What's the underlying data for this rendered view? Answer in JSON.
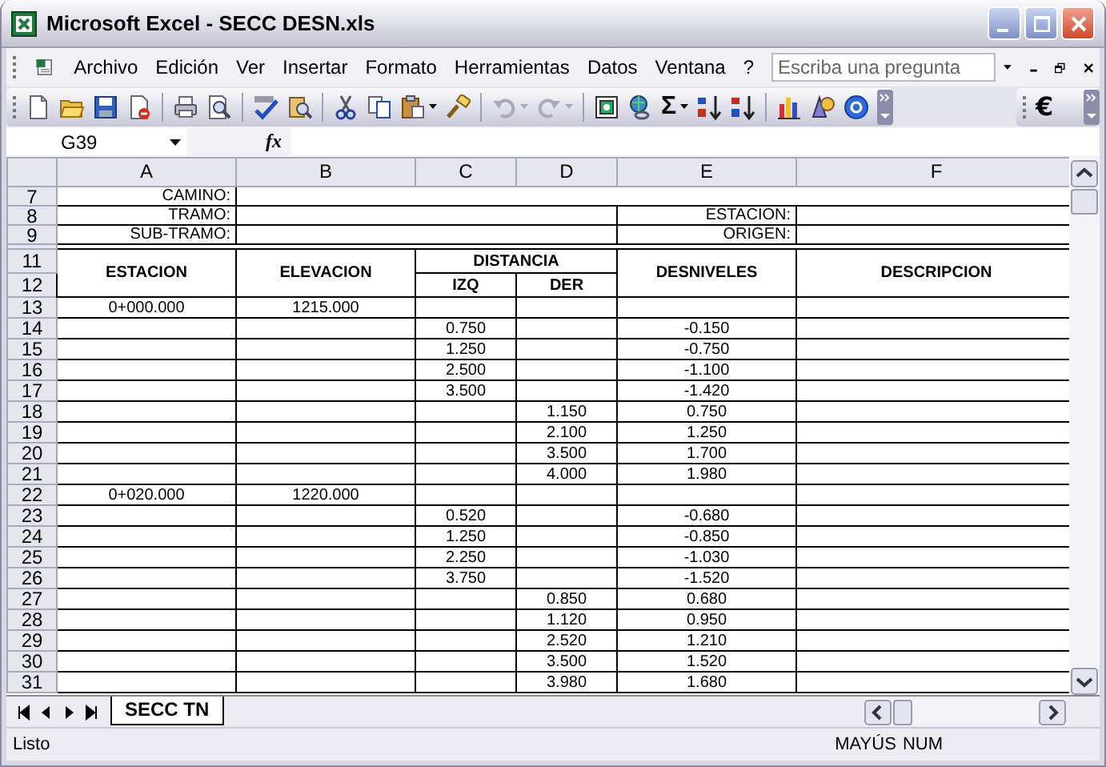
{
  "window": {
    "title": "Microsoft Excel - SECC DESN.xls"
  },
  "menu": [
    {
      "label": "Archivo"
    },
    {
      "label": "Edición"
    },
    {
      "label": "Ver"
    },
    {
      "label": "Insertar"
    },
    {
      "label": "Formato"
    },
    {
      "label": "Herramientas"
    },
    {
      "label": "Datos"
    },
    {
      "label": "Ventana"
    },
    {
      "label": "?"
    }
  ],
  "help_search": {
    "placeholder": "Escriba una pregunta"
  },
  "toolbar": {
    "autosum": "Σ",
    "currency": "€"
  },
  "formula_bar": {
    "name_box": "G39",
    "fx": "fx"
  },
  "columns": [
    "A",
    "B",
    "C",
    "D",
    "E",
    "F"
  ],
  "info_rows": [
    {
      "row": "7",
      "label": "CAMINO:"
    },
    {
      "row": "8",
      "label": "TRAMO:",
      "right_label": "ESTACION:"
    },
    {
      "row": "9",
      "label": "SUB-TRAMO:",
      "right_label": "ORIGEN:"
    }
  ],
  "header": {
    "rows": [
      "11",
      "12"
    ],
    "estacion": "ESTACION",
    "elevacion": "ELEVACION",
    "distancia": "DISTANCIA",
    "izq": "IZQ",
    "der": "DER",
    "desniveles": "DESNIVELES",
    "descripcion": "DESCRIPCION"
  },
  "rows": [
    {
      "row": "13",
      "a": "0+000.000",
      "b": "1215.000"
    },
    {
      "row": "14",
      "c": "0.750",
      "e": "-0.150"
    },
    {
      "row": "15",
      "c": "1.250",
      "e": "-0.750"
    },
    {
      "row": "16",
      "c": "2.500",
      "e": "-1.100"
    },
    {
      "row": "17",
      "c": "3.500",
      "e": "-1.420"
    },
    {
      "row": "18",
      "d": "1.150",
      "e": "0.750"
    },
    {
      "row": "19",
      "d": "2.100",
      "e": "1.250"
    },
    {
      "row": "20",
      "d": "3.500",
      "e": "1.700"
    },
    {
      "row": "21",
      "d": "4.000",
      "e": "1.980"
    },
    {
      "row": "22",
      "a": "0+020.000",
      "b": "1220.000"
    },
    {
      "row": "23",
      "c": "0.520",
      "e": "-0.680"
    },
    {
      "row": "24",
      "c": "1.250",
      "e": "-0.850"
    },
    {
      "row": "25",
      "c": "2.250",
      "e": "-1.030"
    },
    {
      "row": "26",
      "c": "3.750",
      "e": "-1.520"
    },
    {
      "row": "27",
      "d": "0.850",
      "e": "0.680"
    },
    {
      "row": "28",
      "d": "1.120",
      "e": "0.950"
    },
    {
      "row": "29",
      "d": "2.520",
      "e": "1.210"
    },
    {
      "row": "30",
      "d": "3.500",
      "e": "1.520"
    },
    {
      "row": "31",
      "d": "3.980",
      "e": "1.680"
    }
  ],
  "sheet_tabs": [
    {
      "label": "SECC TN",
      "selected": true
    }
  ],
  "status_bar": {
    "text": "Listo",
    "indicators": [
      "MAYÚS",
      "NUM"
    ]
  }
}
